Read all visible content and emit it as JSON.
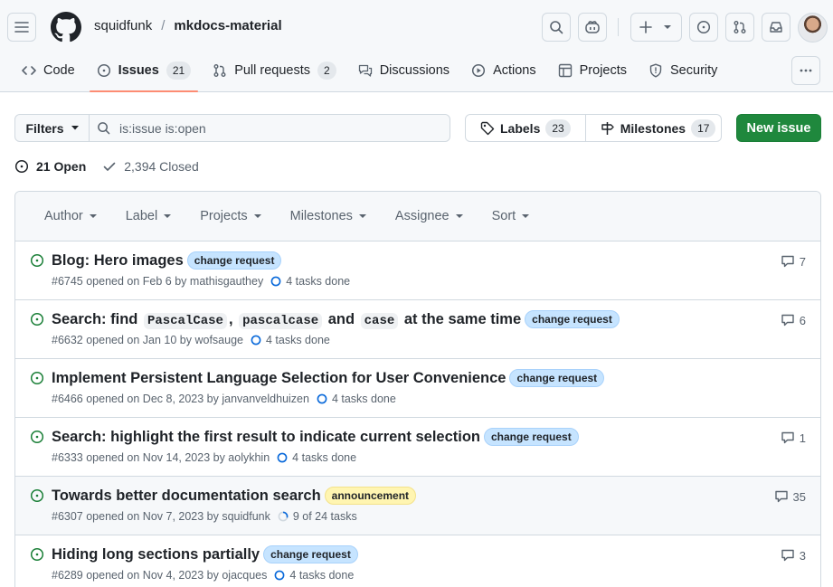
{
  "repo": {
    "owner": "squidfunk",
    "separator": "/",
    "name": "mkdocs-material"
  },
  "tabs": [
    {
      "label": "Code",
      "icon": "code-icon"
    },
    {
      "label": "Issues",
      "icon": "issue-opened-icon",
      "count": "21",
      "selected": true
    },
    {
      "label": "Pull requests",
      "icon": "git-pull-request-icon",
      "count": "2"
    },
    {
      "label": "Discussions",
      "icon": "comment-discussion-icon"
    },
    {
      "label": "Actions",
      "icon": "play-icon"
    },
    {
      "label": "Projects",
      "icon": "table-icon"
    },
    {
      "label": "Security",
      "icon": "shield-icon"
    }
  ],
  "filters": {
    "button_label": "Filters",
    "query": "is:issue is:open"
  },
  "labels_button": {
    "label": "Labels",
    "count": "23"
  },
  "milestones_button": {
    "label": "Milestones",
    "count": "17"
  },
  "new_issue_label": "New issue",
  "states": {
    "open": "21 Open",
    "closed": "2,394 Closed"
  },
  "list_header": [
    "Author",
    "Label",
    "Projects",
    "Milestones",
    "Assignee",
    "Sort"
  ],
  "issues": [
    {
      "title": "Blog: Hero images",
      "label": "change request",
      "label_kind": "cr",
      "meta": "#6745 opened on Feb 6 by mathisgauthey",
      "tasks": "4 tasks done",
      "comments": "7"
    },
    {
      "title_parts": [
        "Search: find ",
        "PascalCase",
        ", ",
        "pascalcase",
        " and ",
        "case",
        " at the same time"
      ],
      "label": "change request",
      "label_kind": "cr",
      "meta": "#6632 opened on Jan 10 by wofsauge",
      "tasks": "4 tasks done",
      "comments": "6"
    },
    {
      "title": "Implement Persistent Language Selection for User Convenience",
      "label": "change request",
      "label_kind": "cr",
      "meta": "#6466 opened on Dec 8, 2023 by janvanveldhuizen",
      "tasks": "4 tasks done",
      "comments": ""
    },
    {
      "title": "Search: highlight the first result to indicate current selection",
      "label": "change request",
      "label_kind": "cr",
      "meta": "#6333 opened on Nov 14, 2023 by aolykhin",
      "tasks": "4 tasks done",
      "comments": "1"
    },
    {
      "title": "Towards better documentation search",
      "label": "announcement",
      "label_kind": "ann",
      "meta": "#6307 opened on Nov 7, 2023 by squidfunk",
      "tasks": "9 of 24 tasks",
      "comments": "35"
    },
    {
      "title": "Hiding long sections partially",
      "label": "change request",
      "label_kind": "cr",
      "meta": "#6289 opened on Nov 4, 2023 by ojacques",
      "tasks": "4 tasks done",
      "comments": "3"
    }
  ],
  "colors": {
    "open_green": "#1a7f37",
    "primary_button": "#1f883d",
    "tab_underline": "#fd8c73",
    "change_request_label": "#c6e4ff",
    "announcement_label": "#fff5b1"
  }
}
